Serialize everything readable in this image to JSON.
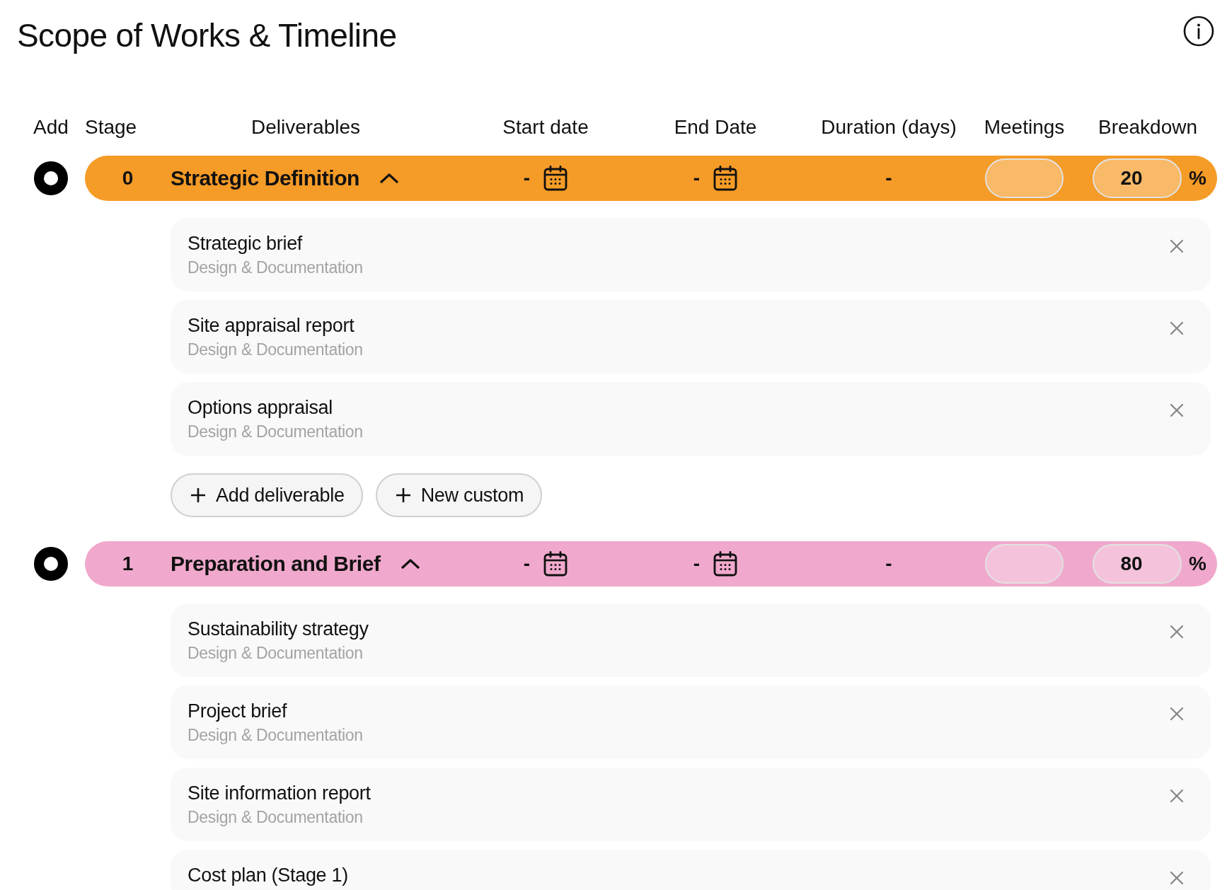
{
  "title": "Scope of Works & Timeline",
  "columns": [
    "Add",
    "Stage",
    "Deliverables",
    "Start date",
    "End Date",
    "Duration (days)",
    "Meetings",
    "Breakdown"
  ],
  "stages": [
    {
      "number": "0",
      "name": "Strategic Definition",
      "color": "#f59b27",
      "expanded": true,
      "start_date": "-",
      "end_date": "-",
      "duration": "-",
      "breakdown": "20",
      "unit": "%",
      "deliverables": [
        {
          "title": "Strategic brief",
          "category": "Design & Documentation"
        },
        {
          "title": "Site appraisal report",
          "category": "Design & Documentation"
        },
        {
          "title": "Options appraisal",
          "category": "Design & Documentation"
        }
      ],
      "actions": [
        "Add deliverable",
        "New custom"
      ]
    },
    {
      "number": "1",
      "name": "Preparation and Brief",
      "color": "#f0a9cc",
      "expanded": true,
      "start_date": "-",
      "end_date": "-",
      "duration": "-",
      "breakdown": "80",
      "unit": "%",
      "deliverables": [
        {
          "title": "Sustainability strategy",
          "category": "Design & Documentation"
        },
        {
          "title": "Project brief",
          "category": "Design & Documentation"
        },
        {
          "title": "Site information report",
          "category": "Design & Documentation"
        },
        {
          "title": "Cost plan (Stage 1)"
        }
      ]
    }
  ]
}
